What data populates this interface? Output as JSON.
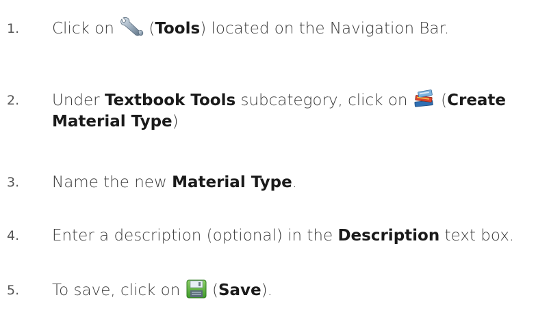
{
  "steps": [
    {
      "number": "1.",
      "pre": "Click on",
      "icon": "wrench-icon",
      "bold": "Tools",
      "post": "located on the Navigation Bar."
    },
    {
      "number": "2.",
      "pre": "Under",
      "bold1": "Textbook Tools",
      "mid": "subcategory, click on",
      "icon": "books-icon",
      "bold2": "Create Material Type"
    },
    {
      "number": "3.",
      "pre": "Name the new",
      "bold": "Material Type",
      "post": "."
    },
    {
      "number": "4.",
      "pre": "Enter a description (optional) in the",
      "bold": "Description",
      "post": "text box."
    },
    {
      "number": "5.",
      "pre": "To save, click on",
      "icon": "save-icon",
      "bold": "Save",
      "post": "."
    }
  ]
}
